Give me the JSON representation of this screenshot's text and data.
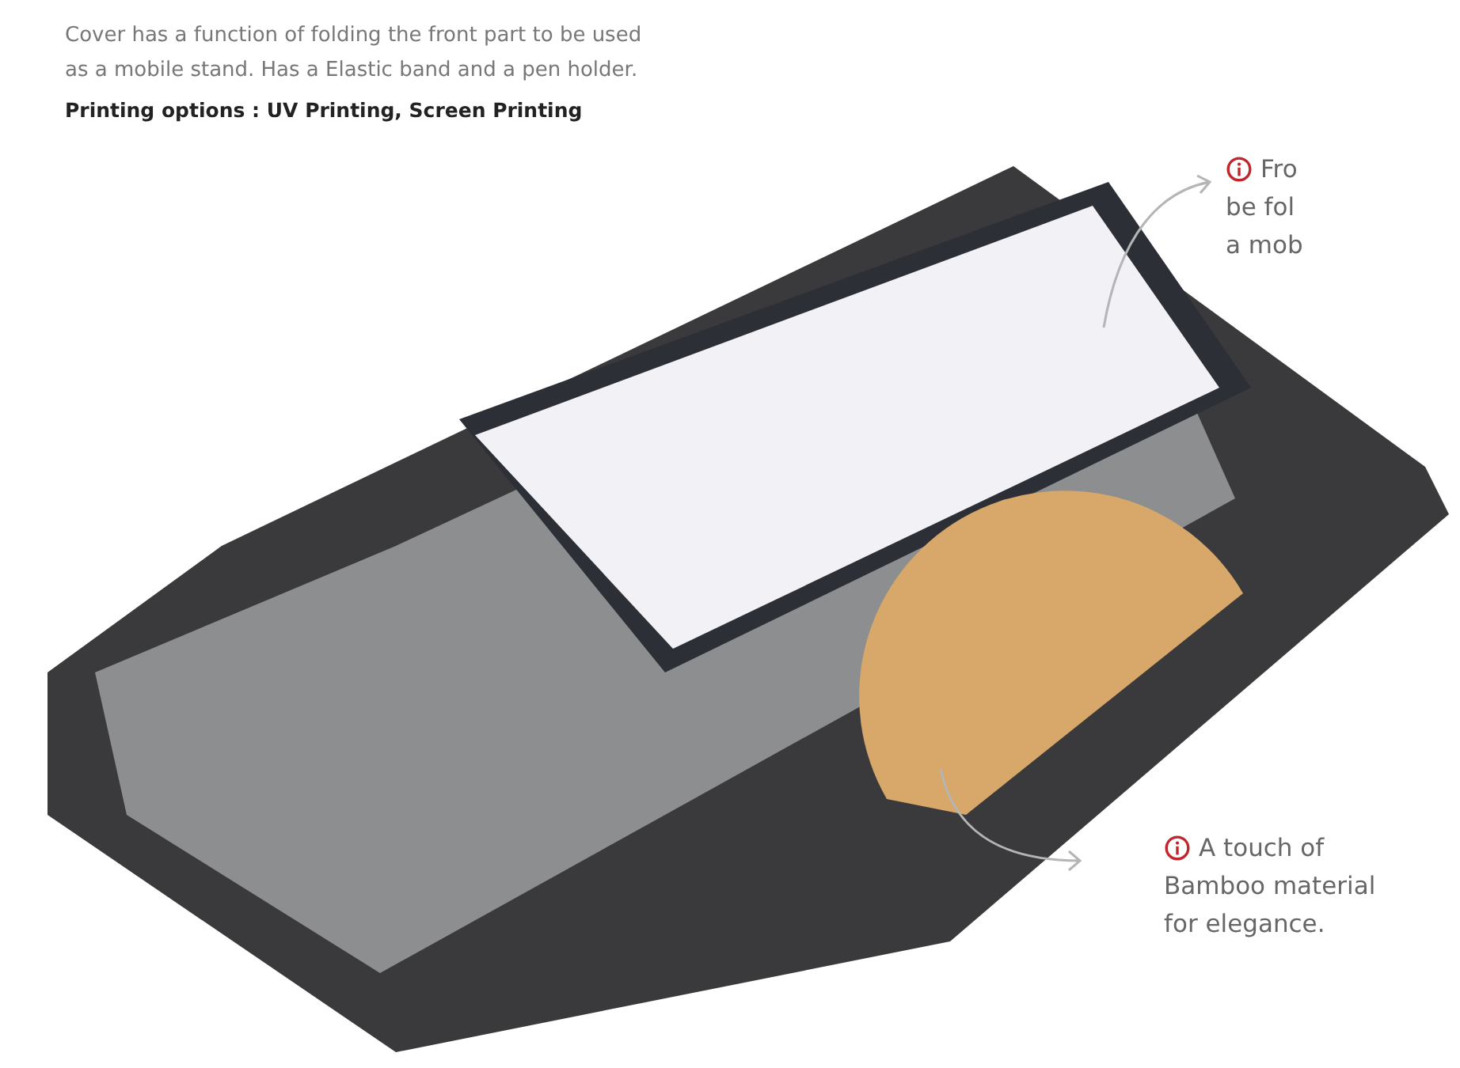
{
  "description": {
    "lines": [
      "Cover has a function of folding the front part to be used",
      "as a mobile stand. Has a Elastic band and a pen holder."
    ],
    "printing": "Printing options : UV Printing, Screen Printing"
  },
  "callouts": [
    {
      "lines": [
        "Fro",
        "be fol",
        "a mob"
      ]
    },
    {
      "lines": [
        "A touch of",
        "Bamboo material",
        "for elegance."
      ]
    }
  ]
}
